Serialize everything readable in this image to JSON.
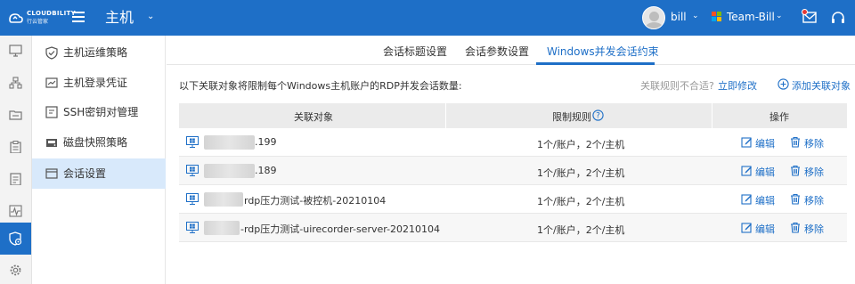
{
  "topbar": {
    "logo_text": "CLOUDBILITY",
    "logo_sub": "行云管家",
    "module_title": "主机",
    "user_name": "bill",
    "team_name": "Team-Bill"
  },
  "submenu": {
    "items": [
      {
        "label": "主机运维策略"
      },
      {
        "label": "主机登录凭证"
      },
      {
        "label": "SSH密钥对管理"
      },
      {
        "label": "磁盘快照策略"
      },
      {
        "label": "会话设置"
      }
    ]
  },
  "tabs": [
    {
      "label": "会话标题设置"
    },
    {
      "label": "会话参数设置"
    },
    {
      "label": "Windows并发会话约束"
    }
  ],
  "description": "以下关联对象将限制每个Windows主机账户的RDP并发会话数量:",
  "hint": "关联规则不合适?",
  "hint_link": "立即修改",
  "add_link": "添加关联对象",
  "table": {
    "headers": [
      "关联对象",
      "限制规则",
      "操作"
    ],
    "rows": [
      {
        "object_suffix": ".199",
        "rule": "1个/账户，2个/主机",
        "edit": "编辑",
        "remove": "移除"
      },
      {
        "object_suffix": ".189",
        "rule": "1个/账户，2个/主机",
        "edit": "编辑",
        "remove": "移除"
      },
      {
        "object_suffix": "rdp压力测试-被控机-20210104",
        "rule": "1个/账户，2个/主机",
        "edit": "编辑",
        "remove": "移除"
      },
      {
        "object_suffix": "-rdp压力测试-uirecorder-server-20210104",
        "rule": "1个/账户，2个/主机",
        "edit": "编辑",
        "remove": "移除"
      }
    ]
  },
  "colors": {
    "brand": "#1e6fc7",
    "active_submenu_bg": "#d8e9fb",
    "table_header_bg": "#ebebeb"
  }
}
